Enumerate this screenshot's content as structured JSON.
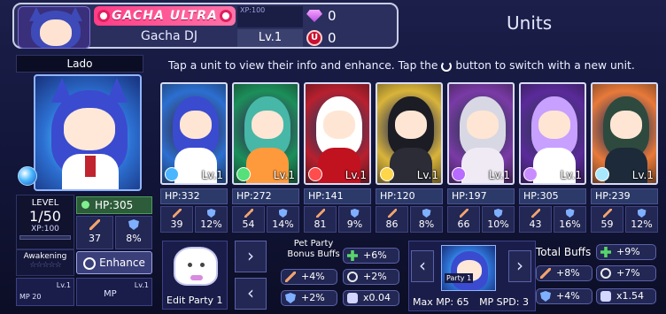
{
  "profile": {
    "tier": "GACHA ULTRA",
    "name": "Gacha DJ",
    "xp_label": "XP:100",
    "level": "Lv.1",
    "gems": "0",
    "coins": "0",
    "coin_symbol": "U"
  },
  "page_title": "Units",
  "instructions_before": "Tap a unit to view their info and enhance. Tap the",
  "instructions_after": "button to switch with a new unit.",
  "selected": {
    "name": "Lado",
    "level_label": "LEVEL",
    "level": "1/50",
    "xp": "XP:100",
    "hp": "HP:305",
    "atk": "37",
    "def": "8%",
    "awakening": "Awakening",
    "awakening_stars": "☆☆☆☆☆",
    "enhance": "Enhance",
    "skill1_mp": "MP 20",
    "skill1_lv": "Lv.1",
    "skill2_label": "MP",
    "skill2_lv": "Lv.1"
  },
  "cards": [
    {
      "lv": "Lv.1",
      "hp": "HP:332",
      "atk": "39",
      "def": "12%",
      "hair": "#3a4bd0",
      "bg": "#2c6fd1",
      "body": "#ffffff",
      "elem": "#49b6ff"
    },
    {
      "lv": "Lv.1",
      "hp": "HP:272",
      "atk": "54",
      "def": "14%",
      "hair": "#47b7a8",
      "bg": "#1c8f5a",
      "body": "#ff9a3c",
      "elem": "#55e07a"
    },
    {
      "lv": "Lv.1",
      "hp": "HP:141",
      "atk": "81",
      "def": "9%",
      "hair": "#ffffff",
      "bg": "#b8202f",
      "body": "#c1121f",
      "elem": "#ff4d4d"
    },
    {
      "lv": "Lv.1",
      "hp": "HP:120",
      "atk": "86",
      "def": "8%",
      "hair": "#1c1c24",
      "bg": "#d9b43a",
      "body": "#2c2c36",
      "elem": "#ffd54a"
    },
    {
      "lv": "Lv.1",
      "hp": "HP:197",
      "atk": "66",
      "def": "10%",
      "hair": "#d8d8e4",
      "bg": "#7a3aa6",
      "body": "#efeaf4",
      "elem": "#b86bff"
    },
    {
      "lv": "Lv.1",
      "hp": "HP:305",
      "atk": "43",
      "def": "16%",
      "hair": "#c8a0ff",
      "bg": "#5a2a9a",
      "body": "#ffffff",
      "elem": "#c98cff"
    },
    {
      "lv": "Lv.1",
      "hp": "HP:239",
      "atk": "59",
      "def": "12%",
      "hair": "#2e4a3e",
      "bg": "#e87a3a",
      "body": "#1c2a3a",
      "elem": "#a8e8ff"
    }
  ],
  "party": {
    "edit_label": "Edit Party 1",
    "pet_title": "Pet Party Bonus Buffs",
    "pet_buffs": [
      "+6%",
      "+4%",
      "+2%",
      "+2%",
      "x0.04"
    ],
    "party_tag": "Party 1",
    "max_mp": "Max MP: 65",
    "mp_spd": "MP SPD: 3",
    "total_title": "Total Buffs",
    "total_buffs": [
      "+9%",
      "+8%",
      "+7%",
      "+4%",
      "x1.54"
    ]
  }
}
